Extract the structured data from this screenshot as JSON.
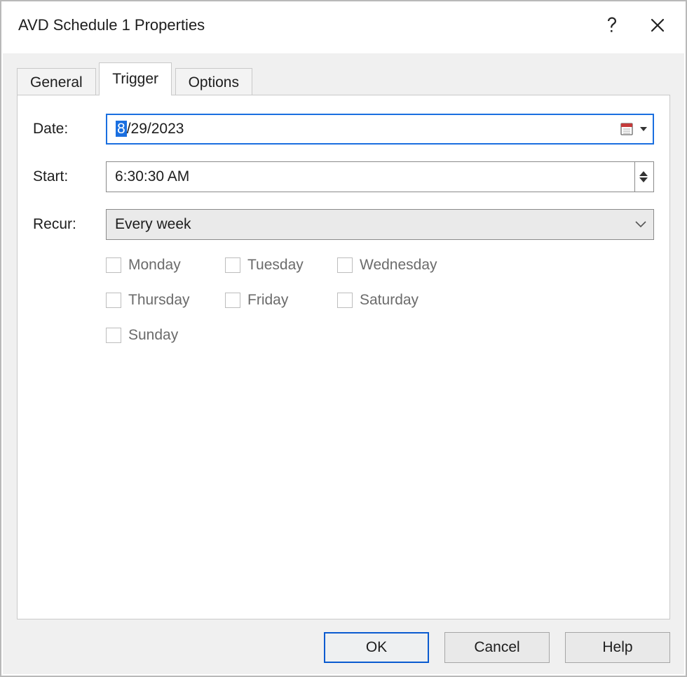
{
  "window": {
    "title": "AVD Schedule 1 Properties"
  },
  "tabs": {
    "general": "General",
    "trigger": "Trigger",
    "options": "Options",
    "active": "trigger"
  },
  "form": {
    "date_label": "Date:",
    "date_value_sel": "8",
    "date_value_rest": "/29/2023",
    "start_label": "Start:",
    "start_value": "6:30:30 AM",
    "recur_label": "Recur:",
    "recur_value": "Every week",
    "days": {
      "mon": "Monday",
      "tue": "Tuesday",
      "wed": "Wednesday",
      "thu": "Thursday",
      "fri": "Friday",
      "sat": "Saturday",
      "sun": "Sunday"
    }
  },
  "buttons": {
    "ok": "OK",
    "cancel": "Cancel",
    "help": "Help"
  }
}
